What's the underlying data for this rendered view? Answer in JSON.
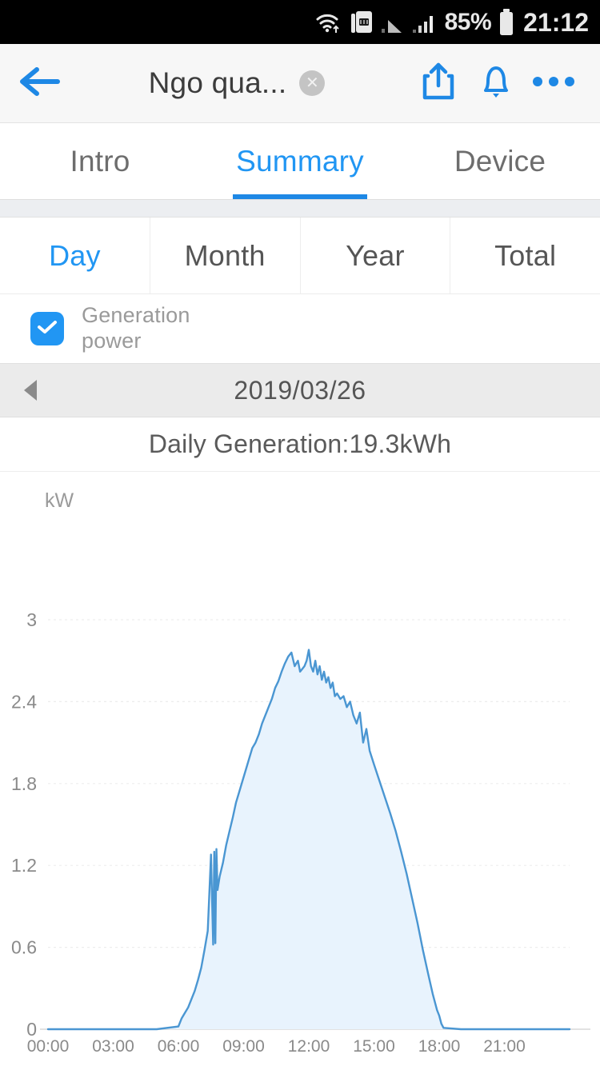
{
  "status_bar": {
    "wifi_icon": "wifi-icon",
    "sim_icon": "dual-sim-icon",
    "signal1_icon": "signal-bars-icon",
    "signal2_icon": "signal-bars-icon",
    "battery_percent": "85%",
    "battery_icon": "battery-icon",
    "time": "21:12"
  },
  "app_bar": {
    "back_icon": "back-arrow-icon",
    "title": "Ngo qua...",
    "clear_icon": "clear-circle-icon",
    "share_icon": "share-icon",
    "bell_icon": "bell-icon",
    "more_icon": "more-dots-icon"
  },
  "tabs": [
    {
      "label": "Intro",
      "active": false
    },
    {
      "label": "Summary",
      "active": true
    },
    {
      "label": "Device",
      "active": false
    }
  ],
  "segments": [
    {
      "label": "Day",
      "active": true
    },
    {
      "label": "Month",
      "active": false
    },
    {
      "label": "Year",
      "active": false
    },
    {
      "label": "Total",
      "active": false
    }
  ],
  "legend": {
    "checked": true,
    "check_icon": "checkmark-icon",
    "label": "Generation power"
  },
  "date_nav": {
    "prev_icon": "triangle-left-icon",
    "date": "2019/03/26"
  },
  "chart_header": {
    "title": "Daily Generation:19.3kWh"
  },
  "colors": {
    "accent": "#2196f3",
    "tab_underline": "#1e88e5",
    "line": "#4a96d2",
    "fill": "#e8f3fd",
    "status_bar_bg": "#000000",
    "app_bar_bg": "#f7f7f7",
    "date_bar_bg": "#ebebeb"
  },
  "chart_data": {
    "type": "area",
    "title": "Daily Generation:19.3kWh",
    "xlabel": "",
    "ylabel": "kW",
    "unit": "kW",
    "grid": true,
    "legend_position": "top-left",
    "series_name": "Generation power",
    "xlim": [
      0,
      24
    ],
    "ylim": [
      0,
      3
    ],
    "yticks": [
      0,
      0.6,
      1.2,
      1.8,
      2.4,
      3
    ],
    "ytick_labels": [
      "0",
      "0.6",
      "1.2",
      "1.8",
      "2.4",
      "3"
    ],
    "xticks": [
      0,
      3,
      6,
      9,
      12,
      15,
      18,
      21
    ],
    "xtick_labels": [
      "00:00",
      "03:00",
      "06:00",
      "09:00",
      "12:00",
      "15:00",
      "18:00",
      "21:00"
    ],
    "x": [
      0,
      1,
      2,
      3,
      4,
      5,
      6,
      6.15,
      6.3,
      6.45,
      6.6,
      6.75,
      6.9,
      7.05,
      7.2,
      7.35,
      7.5,
      7.6,
      7.65,
      7.7,
      7.75,
      7.8,
      7.9,
      8.05,
      8.2,
      8.35,
      8.5,
      8.65,
      8.8,
      8.95,
      9.1,
      9.25,
      9.4,
      9.55,
      9.7,
      9.85,
      10,
      10.15,
      10.3,
      10.45,
      10.6,
      10.75,
      10.9,
      11.05,
      11.2,
      11.35,
      11.5,
      11.6,
      11.7,
      11.8,
      11.9,
      12,
      12.1,
      12.2,
      12.3,
      12.4,
      12.5,
      12.6,
      12.7,
      12.8,
      12.9,
      13,
      13.1,
      13.2,
      13.3,
      13.45,
      13.6,
      13.75,
      13.9,
      14.05,
      14.2,
      14.35,
      14.5,
      14.65,
      14.8,
      15,
      15.25,
      15.5,
      15.75,
      16,
      16.25,
      16.5,
      16.75,
      17,
      17.25,
      17.5,
      17.7,
      17.9,
      18,
      18.1,
      18.2,
      19,
      20,
      21,
      22,
      23,
      24
    ],
    "y": [
      0,
      0,
      0,
      0,
      0,
      0,
      0.02,
      0.08,
      0.12,
      0.16,
      0.22,
      0.28,
      0.36,
      0.45,
      0.58,
      0.72,
      1.28,
      0.62,
      1.3,
      0.63,
      1.32,
      1.02,
      1.12,
      1.22,
      1.35,
      1.45,
      1.55,
      1.66,
      1.74,
      1.82,
      1.9,
      1.98,
      2.06,
      2.1,
      2.16,
      2.24,
      2.3,
      2.36,
      2.42,
      2.5,
      2.55,
      2.62,
      2.68,
      2.73,
      2.76,
      2.66,
      2.7,
      2.62,
      2.64,
      2.66,
      2.7,
      2.78,
      2.66,
      2.62,
      2.7,
      2.6,
      2.66,
      2.56,
      2.62,
      2.54,
      2.58,
      2.5,
      2.54,
      2.44,
      2.46,
      2.42,
      2.44,
      2.36,
      2.4,
      2.3,
      2.24,
      2.32,
      2.1,
      2.2,
      2.04,
      1.94,
      1.82,
      1.7,
      1.58,
      1.45,
      1.3,
      1.14,
      0.96,
      0.78,
      0.58,
      0.4,
      0.26,
      0.14,
      0.1,
      0.04,
      0.01,
      0,
      0,
      0,
      0,
      0,
      0,
      0
    ]
  }
}
